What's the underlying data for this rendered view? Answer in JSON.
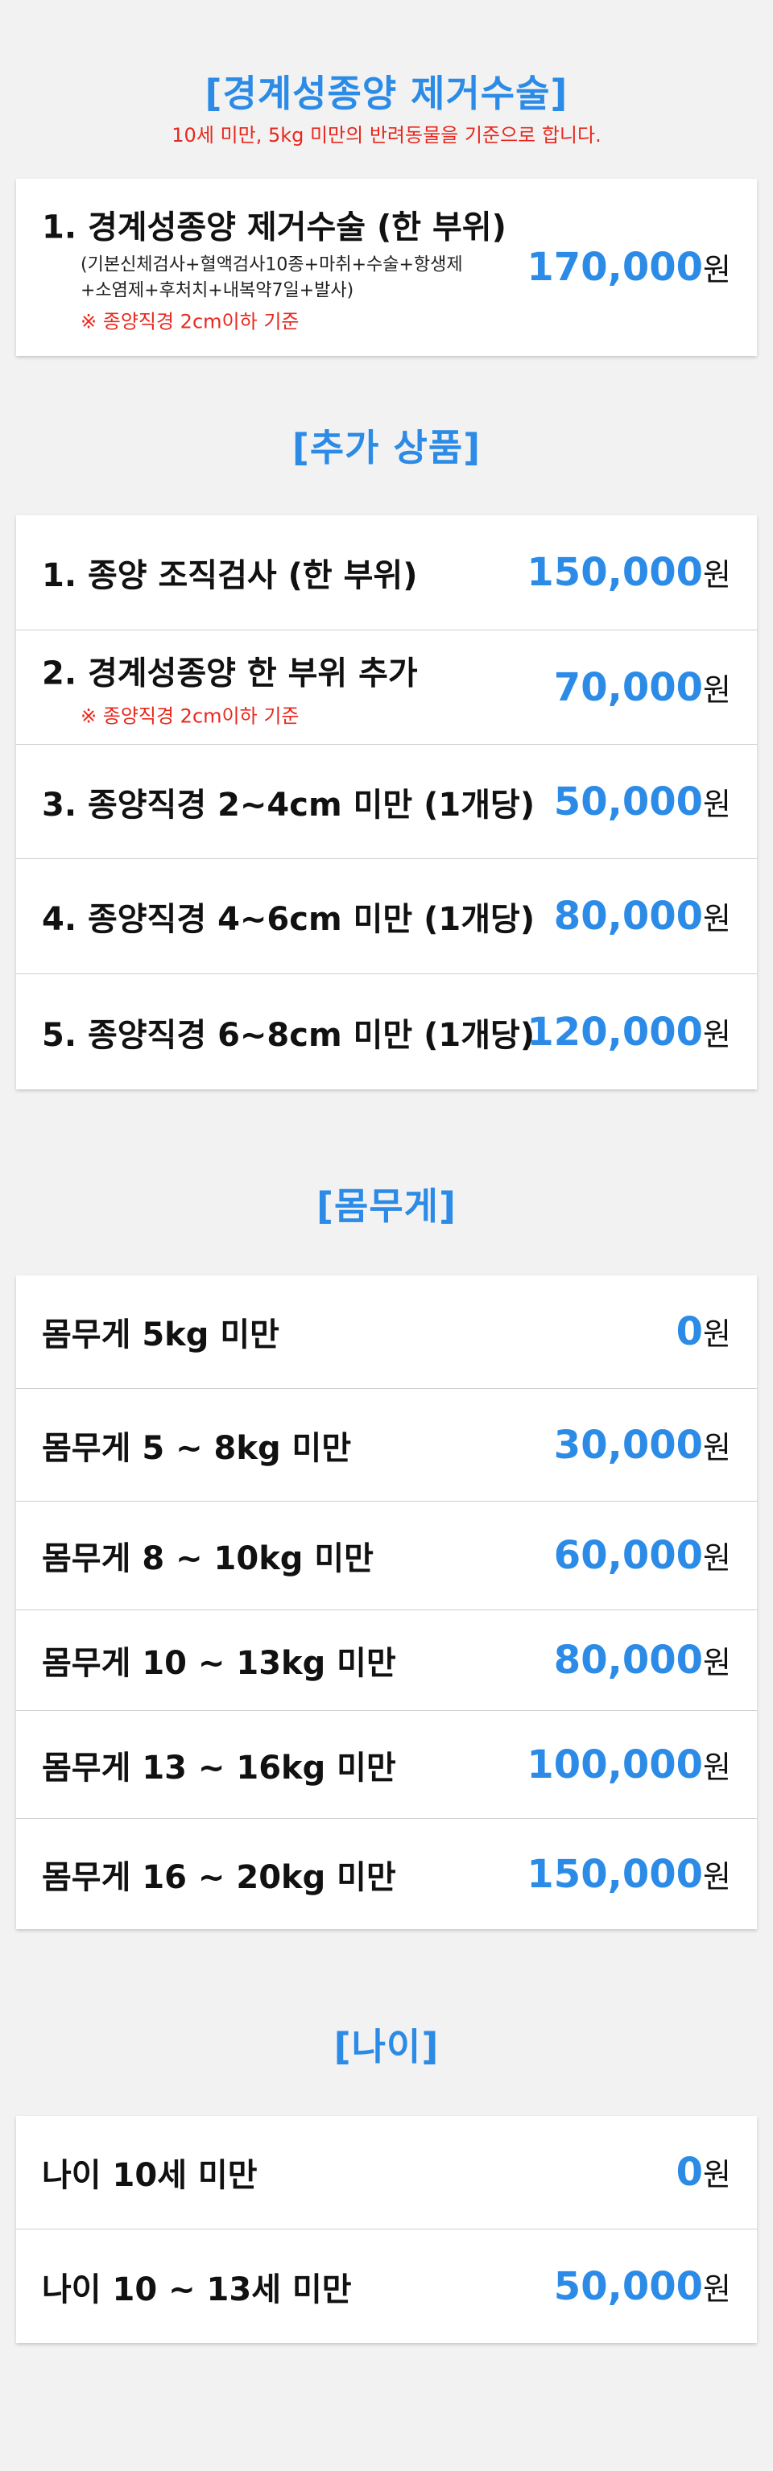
{
  "colors": {
    "accent": "#2b8be6",
    "note": "#e8281e",
    "text": "#111111",
    "background": "#f2f2f2"
  },
  "currency_unit": "원",
  "main": {
    "title": "[경계성종양 제거수술]",
    "subtitle": "10세 미만, 5kg 미만의 반려동물을 기준으로 합니다.",
    "item": {
      "label": "1. 경계성종양 제거수술 (한 부위)",
      "detail_line1": "(기본신체검사+혈액검사10종+마취+수술+항생제",
      "detail_line2": "+소염제+후처치+내복약7일+발사)",
      "note": "※ 종양직경 2cm이하 기준",
      "price": "170,000"
    }
  },
  "additional": {
    "title": "[추가 상품]",
    "items": [
      {
        "label": "1. 종양 조직검사 (한 부위)",
        "price": "150,000"
      },
      {
        "label": "2. 경계성종양 한 부위 추가",
        "note": "※ 종양직경 2cm이하 기준",
        "price": "70,000"
      },
      {
        "label": "3. 종양직경 2~4cm 미만 (1개당)",
        "price": "50,000"
      },
      {
        "label": "4. 종양직경 4~6cm 미만 (1개당)",
        "price": "80,000"
      },
      {
        "label": "5. 종양직경 6~8cm 미만 (1개당)",
        "price": "120,000"
      }
    ]
  },
  "weight": {
    "title": "[몸무게]",
    "items": [
      {
        "label": "몸무게 5kg 미만",
        "price": "0"
      },
      {
        "label": "몸무게 5 ~ 8kg 미만",
        "price": "30,000"
      },
      {
        "label": "몸무게 8 ~ 10kg 미만",
        "price": "60,000"
      },
      {
        "label": "몸무게 10 ~ 13kg 미만",
        "price": "80,000"
      },
      {
        "label": "몸무게 13 ~ 16kg 미만",
        "price": "100,000"
      },
      {
        "label": "몸무게 16 ~ 20kg 미만",
        "price": "150,000"
      }
    ]
  },
  "age": {
    "title": "[나이]",
    "items": [
      {
        "label": "나이 10세 미만",
        "price": "0"
      },
      {
        "label": "나이 10 ~ 13세 미만",
        "price": "50,000"
      }
    ]
  }
}
